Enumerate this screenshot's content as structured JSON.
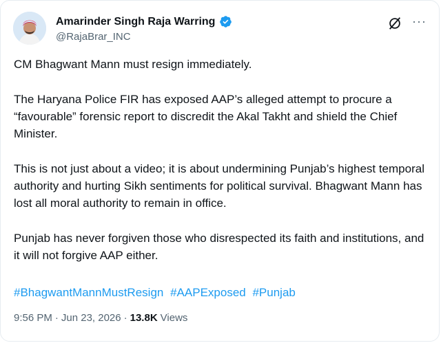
{
  "author": {
    "display_name": "Amarinder Singh Raja Warring",
    "handle": "@RajaBrar_INC",
    "verified_color": "#1d9bf0"
  },
  "actions": {
    "grok_icon": "grok-slash-circle-icon",
    "more_icon": "more-horizontal-icon",
    "more_label": "···"
  },
  "tweet": {
    "paragraphs": [
      "CM Bhagwant Mann must resign immediately.",
      "The Haryana Police FIR has exposed AAP’s alleged attempt to procure a “favourable” forensic report to discredit the Akal Takht and shield the Chief Minister.",
      "This is not just about a video; it is about undermining Punjab’s highest temporal authority and hurting Sikh sentiments for political survival. Bhagwant Mann has lost all moral authority to remain in office.",
      "Punjab has never forgiven those who disrespected its faith and institutions, and it will not forgive AAP either."
    ],
    "hashtags": [
      "#BhagwantMannMustResign",
      "#AAPExposed",
      "#Punjab"
    ]
  },
  "meta": {
    "time": "9:56 PM",
    "separator": "·",
    "date": "Jun 23, 2026",
    "separator2": "·",
    "views_count": "13.8K",
    "views_label": "Views"
  },
  "colors": {
    "link": "#1d9bf0",
    "text": "#0f1419",
    "secondary": "#536471"
  }
}
